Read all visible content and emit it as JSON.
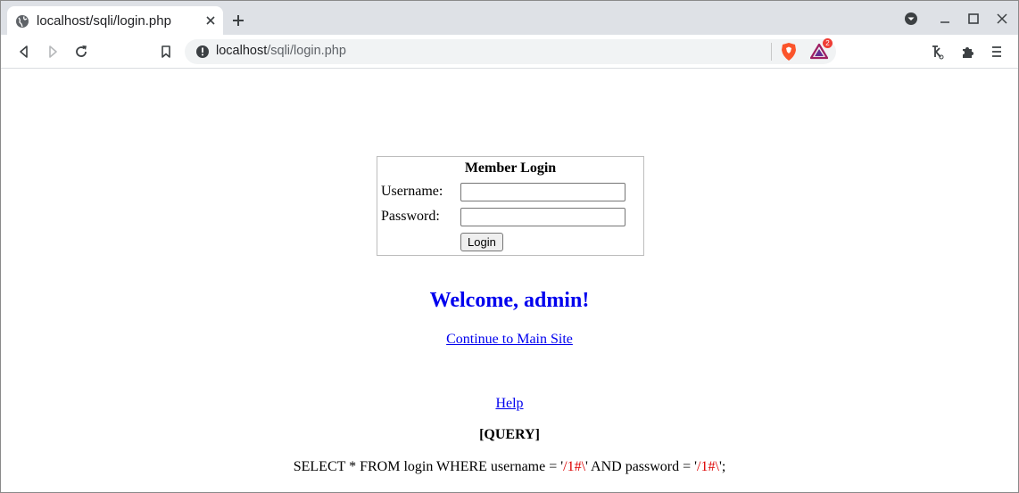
{
  "browser": {
    "tab_title": "localhost/sqli/login.php",
    "url_host": "localhost",
    "url_path": "/sqli/login.php",
    "extension_badge_count": "2",
    "icons": [
      "globe-icon",
      "close-icon",
      "plus-icon",
      "back-icon",
      "forward-icon",
      "reload-icon",
      "bookmark-icon",
      "info-icon",
      "brave-shield-icon",
      "brave-rewards-icon",
      "extension-k-icon",
      "puzzle-icon",
      "menu-icon",
      "tab-search-icon",
      "minimize-icon",
      "maximize-icon"
    ]
  },
  "login": {
    "title": "Member Login",
    "username_label": "Username:",
    "password_label": "Password:",
    "username_value": "",
    "password_value": "",
    "button_label": "Login"
  },
  "result": {
    "welcome": "Welcome, admin!",
    "continue_link": "Continue to Main Site",
    "help_link": "Help",
    "query_heading": "[QUERY]",
    "query_part1": "SELECT * FROM login WHERE username = '",
    "query_user": "/1#\\",
    "query_part2": "' AND password = '",
    "query_pass": "/1#\\",
    "query_part3": "';"
  },
  "colors": {
    "link": "#0000ee",
    "query_value": "#dd0000",
    "tab_strip": "#dee1e6"
  }
}
